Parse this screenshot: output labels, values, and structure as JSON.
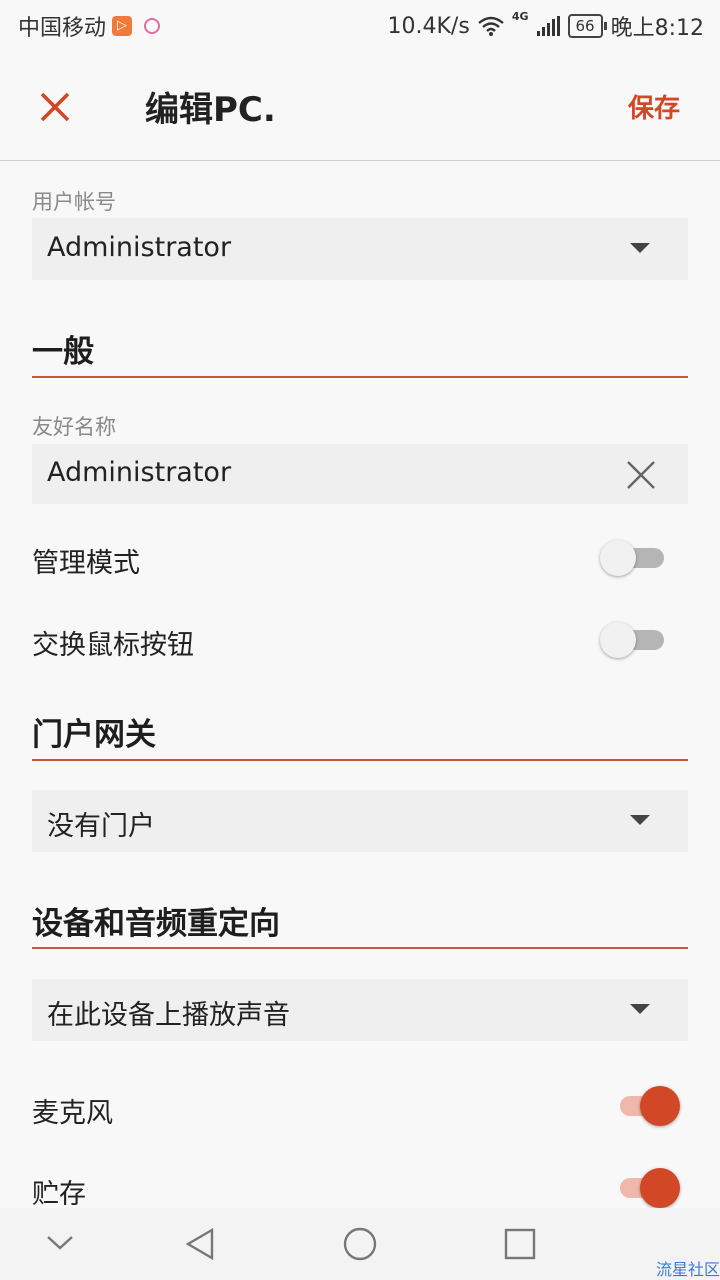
{
  "status_bar": {
    "carrier": "中国移动",
    "app_badge": "▷",
    "net_speed": "10.4K/s",
    "network_type": "4G",
    "battery": "66",
    "time": "晚上8:12"
  },
  "toolbar": {
    "title": "编辑PC.",
    "save_label": "保存",
    "close_icon": "close-icon"
  },
  "user_account": {
    "label": "用户帐号",
    "value": "Administrator"
  },
  "general": {
    "title": "一般",
    "friendly_name_label": "友好名称",
    "friendly_name_value": "Administrator",
    "admin_mode_label": "管理模式",
    "admin_mode_on": false,
    "swap_mouse_label": "交换鼠标按钮",
    "swap_mouse_on": false
  },
  "gateway": {
    "title": "门户网关",
    "value": "没有门户"
  },
  "redirection": {
    "title": "设备和音频重定向",
    "sound_value": "在此设备上播放声音",
    "microphone_label": "麦克风",
    "microphone_on": true,
    "storage_label": "贮存",
    "storage_on": true
  },
  "watermark": "流星社区",
  "colors": {
    "accent": "#d24726",
    "background": "#f8f8f8"
  }
}
